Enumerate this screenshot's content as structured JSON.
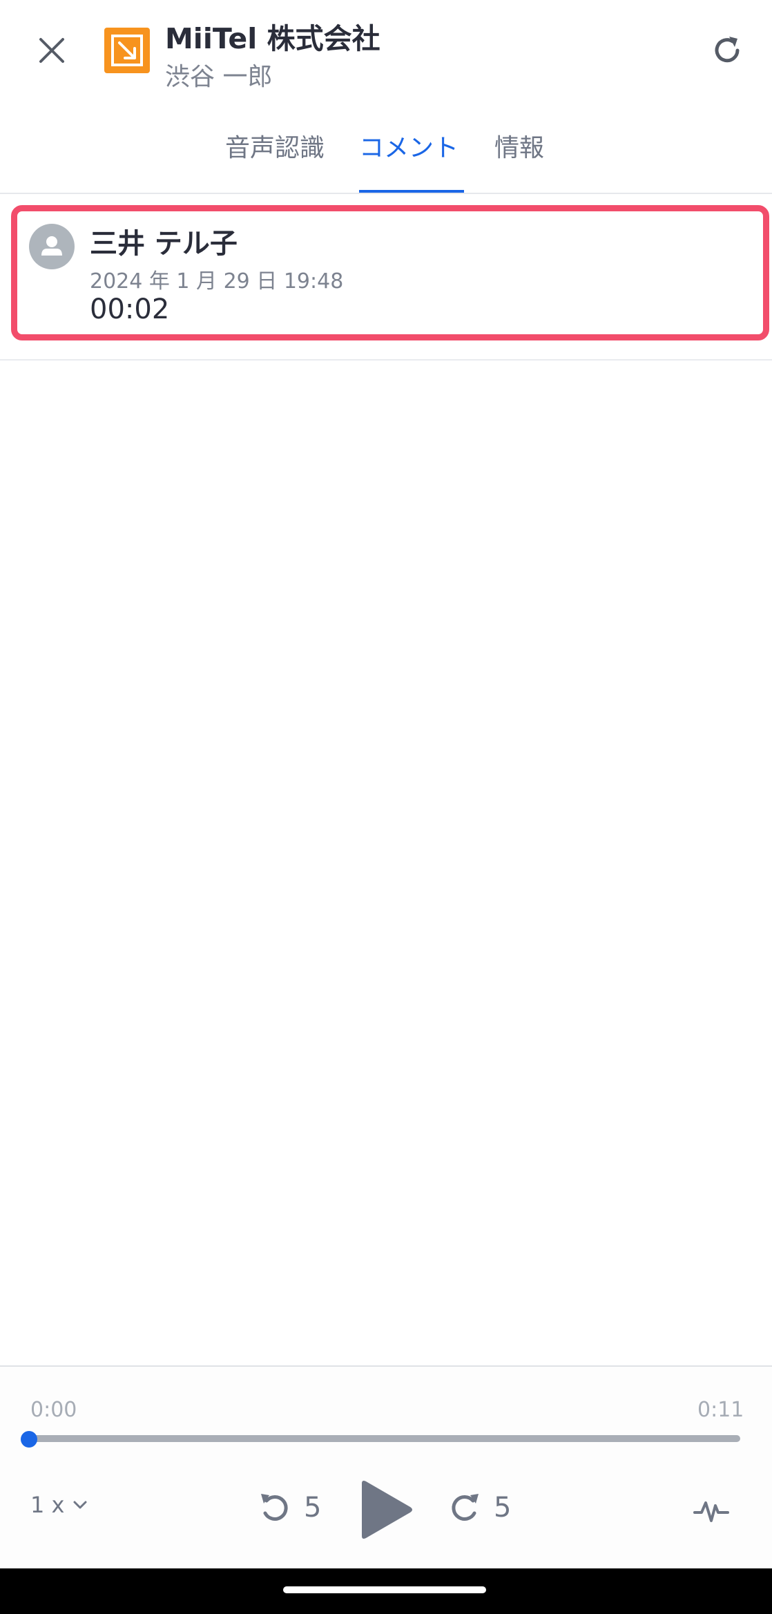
{
  "header": {
    "title": "MiiTel 株式会社",
    "subtitle": "渋谷 一郎",
    "logo_color": "#f7931e"
  },
  "tabs": [
    {
      "label": "音声認識",
      "active": false
    },
    {
      "label": "コメント",
      "active": true
    },
    {
      "label": "情報",
      "active": false
    }
  ],
  "comment": {
    "author": "三井 テル子",
    "date": "2024 年 1 月 29 日 19:48",
    "timestamp": "00:02",
    "highlight_color": "#f24d6b"
  },
  "player": {
    "time_start": "0:00",
    "time_end": "0:11",
    "progress": 0,
    "speed_label": "1 x",
    "rewind_label": "5",
    "forward_label": "5",
    "accent": "#1a66e6"
  }
}
